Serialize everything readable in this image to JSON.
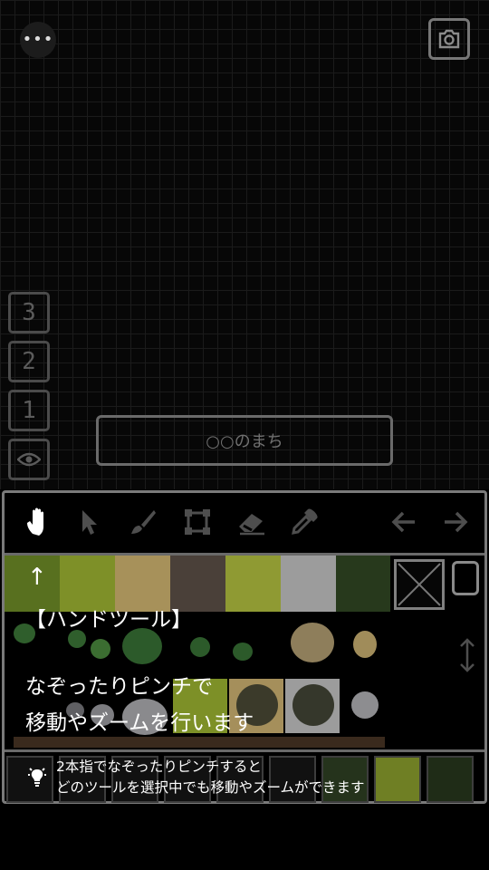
{
  "canvas": {
    "menu_button": {
      "icon": "more-horizontal-icon",
      "label": "•••"
    },
    "camera_button": {
      "icon": "camera-icon"
    }
  },
  "layers": [
    {
      "label": "3"
    },
    {
      "label": "2"
    },
    {
      "label": "1"
    },
    {
      "icon": "eye-icon"
    }
  ],
  "map_name": "○○のまち",
  "toolbar": {
    "tools": [
      {
        "name": "hand-tool",
        "icon": "hand-icon",
        "selected": true
      },
      {
        "name": "select-tool",
        "icon": "pointer-icon",
        "selected": false
      },
      {
        "name": "brush-tool",
        "icon": "brush-icon",
        "selected": false
      },
      {
        "name": "rect-tool",
        "icon": "rectangle-select-icon",
        "selected": false
      },
      {
        "name": "eraser-tool",
        "icon": "eraser-icon",
        "selected": false
      },
      {
        "name": "eyedropper-tool",
        "icon": "eyedropper-icon",
        "selected": false
      }
    ],
    "undo_icon": "arrow-left-icon",
    "redo_icon": "arrow-right-icon"
  },
  "palette": {
    "ground_colors": [
      "#58701f",
      "#7e9028",
      "#a7915a",
      "#4a4039",
      "#8f9a33",
      "#9c9c9c",
      "#27391c"
    ]
  },
  "tutorial": {
    "arrow": "↑",
    "title": "【ハンドツール】",
    "description_lines": [
      "なぞったりピンチで",
      "移動やズームを行います"
    ]
  },
  "tip": {
    "icon": "lightbulb-icon",
    "lines": [
      "2本指でなぞったりピンチすると",
      "どのツールを選択中でも移動やズームができます"
    ]
  }
}
